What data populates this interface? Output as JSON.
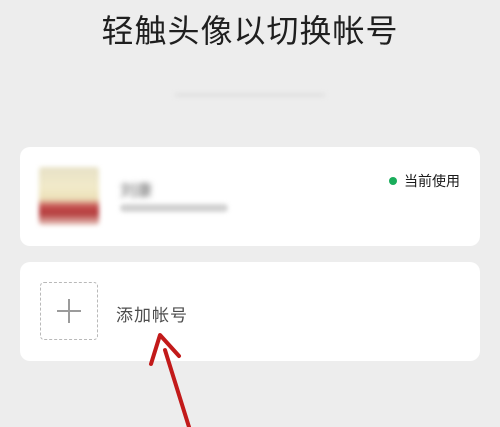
{
  "header": {
    "title": "轻触头像以切换帐号"
  },
  "accounts": [
    {
      "name": "刘康",
      "status_label": "当前使用",
      "status_color": "#1aad5b"
    }
  ],
  "add_account": {
    "label": "添加帐号"
  },
  "annotation": {
    "arrow_color": "#c21a1a"
  }
}
